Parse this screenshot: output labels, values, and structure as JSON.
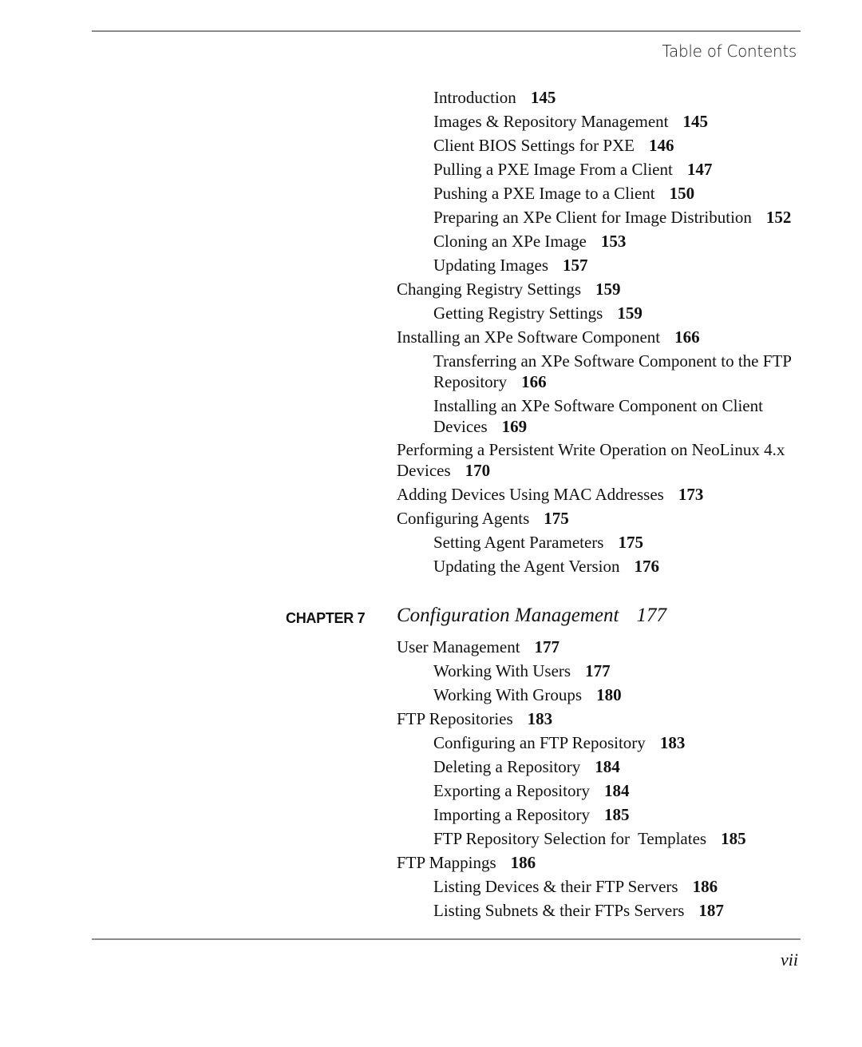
{
  "header": {
    "running_head": "Table of Contents"
  },
  "entries_a": [
    {
      "level": 2,
      "title": "Introduction",
      "page": "145"
    },
    {
      "level": 2,
      "title": "Images & Repository Management",
      "page": "145"
    },
    {
      "level": 2,
      "title": "Client BIOS Settings for PXE",
      "page": "146"
    },
    {
      "level": 2,
      "title": "Pulling a PXE Image From a Client",
      "page": "147"
    },
    {
      "level": 2,
      "title": "Pushing a PXE Image to a Client",
      "page": "150"
    },
    {
      "level": 2,
      "title": "Preparing an XPe Client for Image Distribution",
      "page": "152"
    },
    {
      "level": 2,
      "title": "Cloning an XPe Image",
      "page": "153"
    },
    {
      "level": 2,
      "title": "Updating Images",
      "page": "157"
    },
    {
      "level": 1,
      "title": "Changing Registry Settings",
      "page": "159"
    },
    {
      "level": 2,
      "title": "Getting Registry Settings",
      "page": "159"
    },
    {
      "level": 1,
      "title": "Installing an XPe Software Component",
      "page": "166"
    },
    {
      "level": 2,
      "title": "Transferring an XPe Software Component to the FTP Repository",
      "page": "166"
    },
    {
      "level": 2,
      "title": "Installing an XPe Software Component on Client Devices",
      "page": "169"
    },
    {
      "level": 1,
      "title": "Performing a Persistent Write Operation on NeoLinux 4.x Devices",
      "page": "170"
    },
    {
      "level": 1,
      "title": "Adding Devices Using MAC Addresses",
      "page": "173"
    },
    {
      "level": 1,
      "title": "Configuring Agents",
      "page": "175"
    },
    {
      "level": 2,
      "title": "Setting Agent Parameters",
      "page": "175"
    },
    {
      "level": 2,
      "title": "Updating the Agent Version",
      "page": "176"
    }
  ],
  "chapter": {
    "label": "CHAPTER 7",
    "title": "Configuration Management",
    "page": "177"
  },
  "entries_b": [
    {
      "level": 1,
      "title": "User Management",
      "page": "177"
    },
    {
      "level": 2,
      "title": "Working With Users",
      "page": "177"
    },
    {
      "level": 2,
      "title": "Working With Groups",
      "page": "180"
    },
    {
      "level": 1,
      "title": "FTP Repositories",
      "page": "183"
    },
    {
      "level": 2,
      "title": "Configuring an FTP Repository",
      "page": "183"
    },
    {
      "level": 2,
      "title": "Deleting a Repository",
      "page": "184"
    },
    {
      "level": 2,
      "title": "Exporting a Repository",
      "page": "184"
    },
    {
      "level": 2,
      "title": "Importing a Repository",
      "page": "185"
    },
    {
      "level": 2,
      "title": "FTP Repository Selection for  Templates",
      "page": "185"
    },
    {
      "level": 1,
      "title": "FTP Mappings",
      "page": "186"
    },
    {
      "level": 2,
      "title": "Listing Devices & their FTP Servers",
      "page": "186"
    },
    {
      "level": 2,
      "title": "Listing Subnets & their FTPs Servers",
      "page": "187"
    }
  ],
  "footer": {
    "folio": "vii"
  }
}
